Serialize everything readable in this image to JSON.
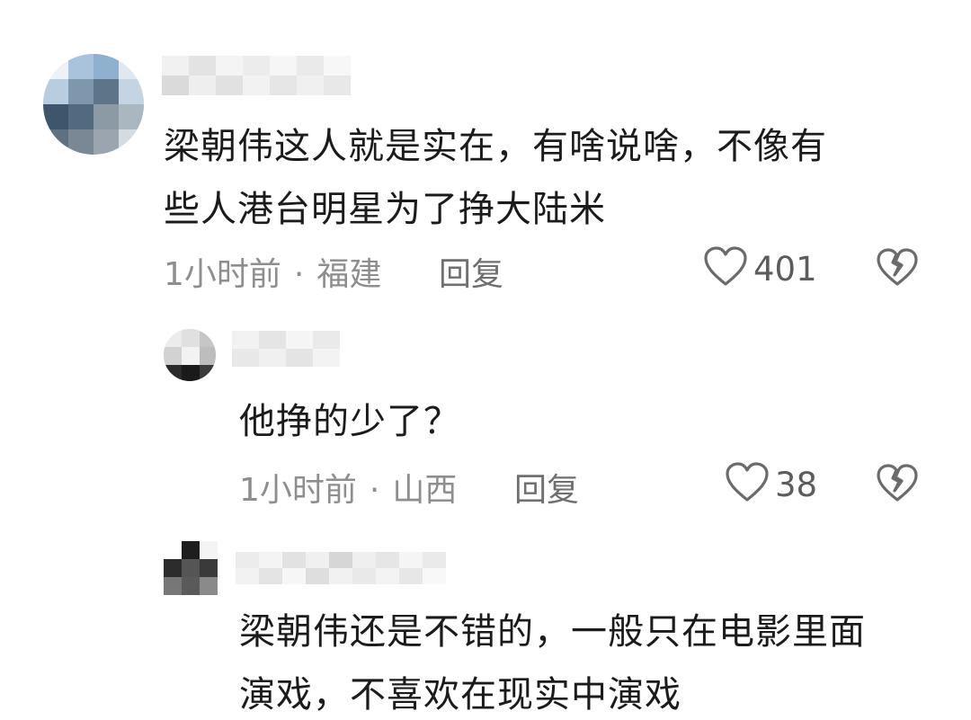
{
  "comments": [
    {
      "text": "梁朝伟这人就是实在，有啥说啥，不像有\n些人港台明星为了挣大陆米",
      "time": "1小时前",
      "location": "福建",
      "separator": "·",
      "reply_label": "回复",
      "likes": "401",
      "like_icon": "heart-outline-icon",
      "dislike_icon": "broken-heart-icon"
    },
    {
      "text": "他挣的少了？",
      "time": "1小时前",
      "location": "山西",
      "separator": "·",
      "reply_label": "回复",
      "likes": "38",
      "like_icon": "heart-outline-icon",
      "dislike_icon": "broken-heart-icon"
    },
    {
      "text": "梁朝伟还是不错的，一般只在电影里面\n演戏，不喜欢在现实中演戏",
      "time": "",
      "location": "",
      "separator": "",
      "reply_label": "",
      "likes": "",
      "like_icon": "",
      "dislike_icon": ""
    }
  ],
  "colors": {
    "text": "#1b1b1b",
    "meta": "#8e8e8e",
    "icon": "#6b6b6b",
    "background": "#ffffff"
  }
}
